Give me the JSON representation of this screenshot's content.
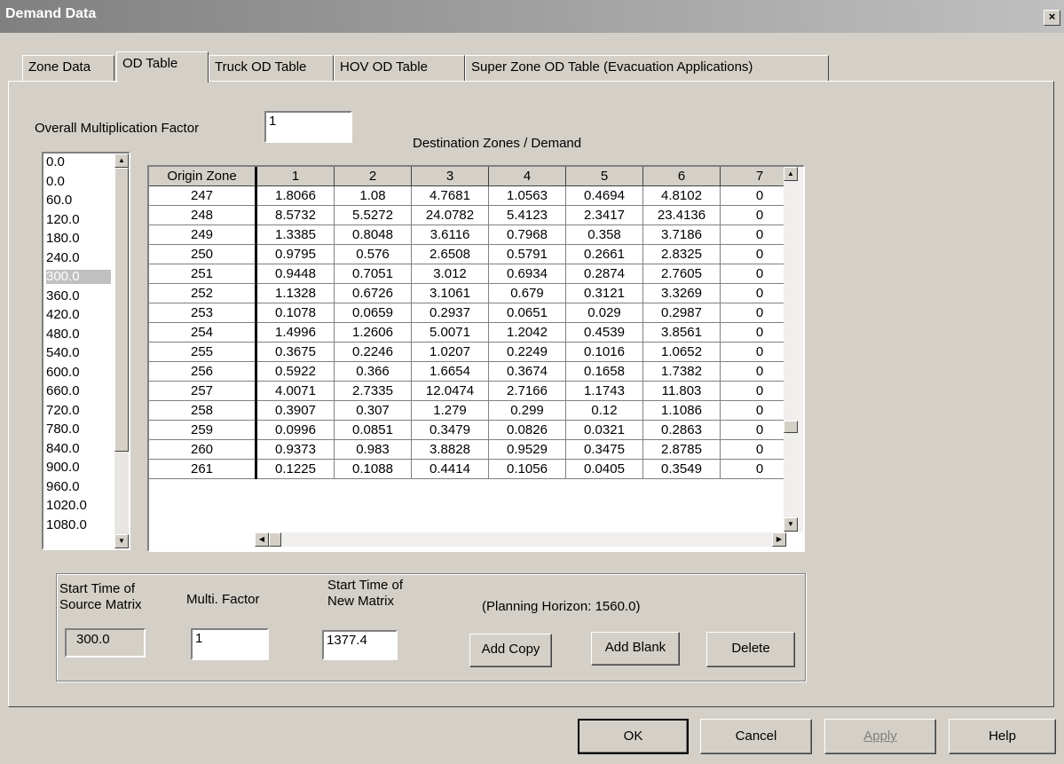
{
  "window": {
    "title": "Demand Data",
    "close_glyph": "×"
  },
  "tabs": [
    {
      "label": "Zone Data",
      "active": false
    },
    {
      "label": "OD Table",
      "active": true
    },
    {
      "label": "Truck OD Table",
      "active": false
    },
    {
      "label": "HOV OD Table",
      "active": false
    },
    {
      "label": "Super Zone OD Table (Evacuation Applications)",
      "active": false
    }
  ],
  "overall": {
    "label": "Overall Multiplication Factor",
    "value": "1"
  },
  "grid_caption": "Destination Zones / Demand",
  "time_list": {
    "items": [
      "0.0",
      "0.0",
      "60.0",
      "120.0",
      "180.0",
      "240.0",
      "300.0",
      "360.0",
      "420.0",
      "480.0",
      "540.0",
      "600.0",
      "660.0",
      "720.0",
      "780.0",
      "840.0",
      "900.0",
      "960.0",
      "1020.0",
      "1080.0"
    ],
    "selected": "300.0"
  },
  "od_table": {
    "header": [
      "Origin Zone",
      "1",
      "2",
      "3",
      "4",
      "5",
      "6",
      "7"
    ],
    "rows": [
      [
        "247",
        "1.8066",
        "1.08",
        "4.7681",
        "1.0563",
        "0.4694",
        "4.8102",
        "0"
      ],
      [
        "248",
        "8.5732",
        "5.5272",
        "24.0782",
        "5.4123",
        "2.3417",
        "23.4136",
        "0"
      ],
      [
        "249",
        "1.3385",
        "0.8048",
        "3.6116",
        "0.7968",
        "0.358",
        "3.7186",
        "0"
      ],
      [
        "250",
        "0.9795",
        "0.576",
        "2.6508",
        "0.5791",
        "0.2661",
        "2.8325",
        "0"
      ],
      [
        "251",
        "0.9448",
        "0.7051",
        "3.012",
        "0.6934",
        "0.2874",
        "2.7605",
        "0"
      ],
      [
        "252",
        "1.1328",
        "0.6726",
        "3.1061",
        "0.679",
        "0.3121",
        "3.3269",
        "0"
      ],
      [
        "253",
        "0.1078",
        "0.0659",
        "0.2937",
        "0.0651",
        "0.029",
        "0.2987",
        "0"
      ],
      [
        "254",
        "1.4996",
        "1.2606",
        "5.0071",
        "1.2042",
        "0.4539",
        "3.8561",
        "0"
      ],
      [
        "255",
        "0.3675",
        "0.2246",
        "1.0207",
        "0.2249",
        "0.1016",
        "1.0652",
        "0"
      ],
      [
        "256",
        "0.5922",
        "0.366",
        "1.6654",
        "0.3674",
        "0.1658",
        "1.7382",
        "0"
      ],
      [
        "257",
        "4.0071",
        "2.7335",
        "12.0474",
        "2.7166",
        "1.1743",
        "11.803",
        "0"
      ],
      [
        "258",
        "0.3907",
        "0.307",
        "1.279",
        "0.299",
        "0.12",
        "1.1086",
        "0"
      ],
      [
        "259",
        "0.0996",
        "0.0851",
        "0.3479",
        "0.0826",
        "0.0321",
        "0.2863",
        "0"
      ],
      [
        "260",
        "0.9373",
        "0.983",
        "3.8828",
        "0.9529",
        "0.3475",
        "2.8785",
        "0"
      ],
      [
        "261",
        "0.1225",
        "0.1088",
        "0.4414",
        "0.1056",
        "0.0405",
        "0.3549",
        "0"
      ]
    ]
  },
  "matrix": {
    "source_label_1": "Start Time of",
    "source_label_2": "Source Matrix",
    "source_value": "300.0",
    "factor_label": "Multi. Factor",
    "factor_value": "1",
    "new_label_1": "Start Time of",
    "new_label_2": "New Matrix",
    "new_value": "1377.4",
    "horizon": "(Planning Horizon: 1560.0)",
    "add_copy": "Add Copy",
    "add_blank": "Add Blank",
    "delete": "Delete"
  },
  "footer": {
    "ok": "OK",
    "cancel": "Cancel",
    "apply": "Apply",
    "help": "Help"
  },
  "icons": {
    "up": "▲",
    "down": "▼",
    "left": "◀",
    "right": "▶"
  }
}
